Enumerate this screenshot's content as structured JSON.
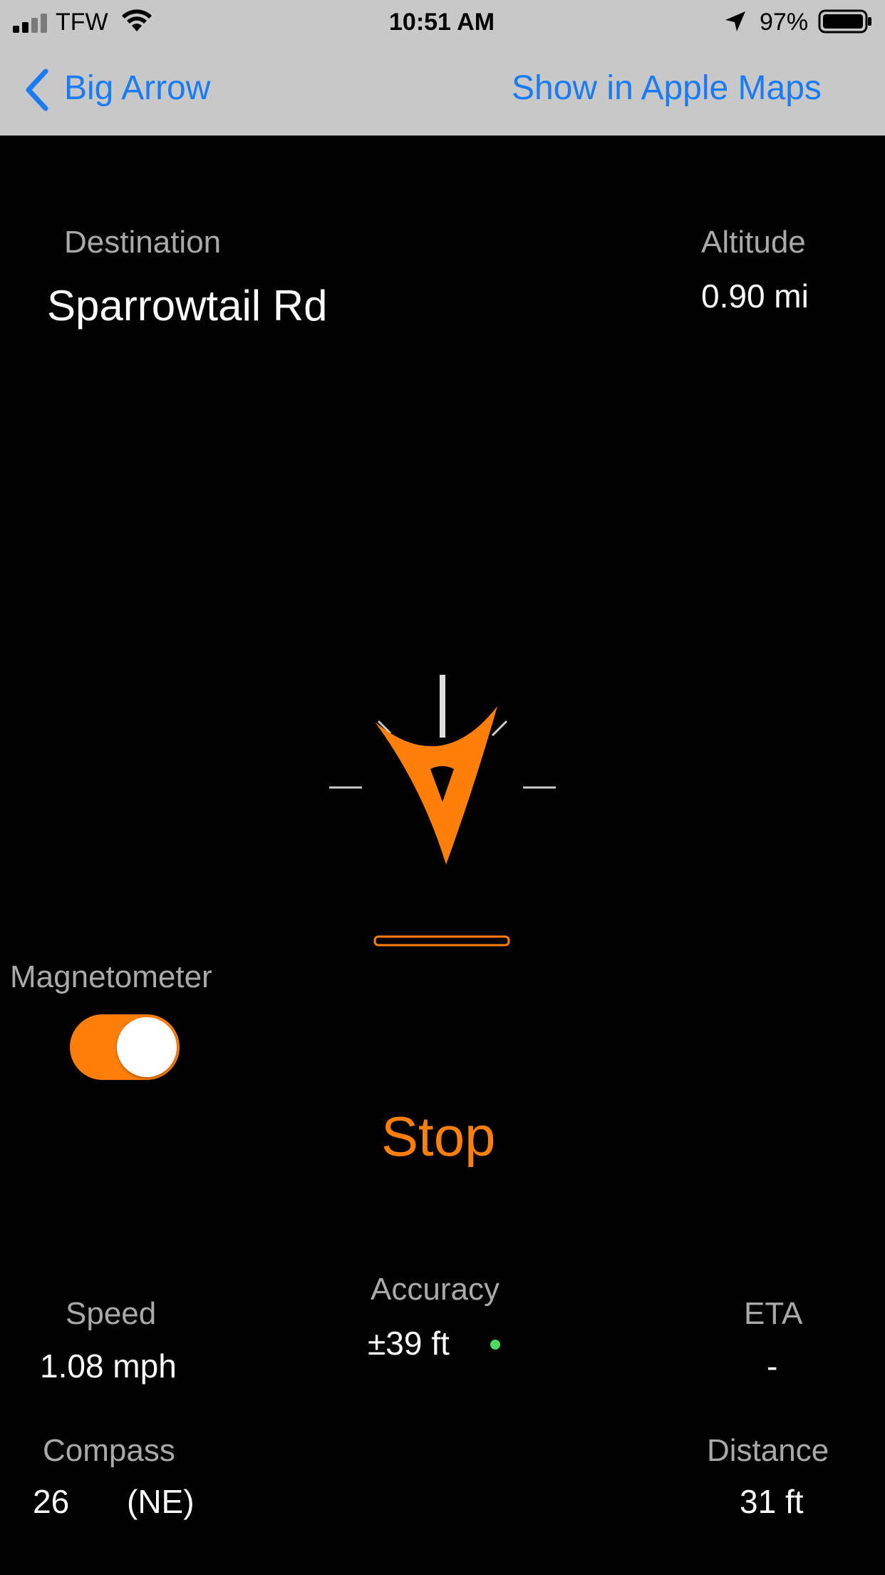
{
  "status_bar": {
    "carrier": "TFW",
    "time": "10:51 AM",
    "battery_percent": "97%"
  },
  "nav": {
    "back_label": "Big Arrow",
    "action_label": "Show in Apple Maps"
  },
  "destination": {
    "label": "Destination",
    "value": "Sparrowtail Rd"
  },
  "altitude": {
    "label": "Altitude",
    "value": "0.90 mi"
  },
  "magnetometer": {
    "label": "Magnetometer",
    "enabled": true
  },
  "stop_label": "Stop",
  "accuracy": {
    "label": "Accuracy",
    "value": "±39 ft",
    "indicator_color": "#4cd964"
  },
  "speed": {
    "label": "Speed",
    "value": "1.08 mph"
  },
  "eta": {
    "label": "ETA",
    "value": "-"
  },
  "compass": {
    "label": "Compass",
    "degrees": "26",
    "direction": "(NE)"
  },
  "distance": {
    "label": "Distance",
    "value": "31 ft"
  },
  "colors": {
    "accent": "#ff7f0a",
    "link": "#1a7cf5",
    "header_bg": "#c8c8c8"
  },
  "icons": [
    "cellular-signal-icon",
    "wifi-icon",
    "location-arrow-icon",
    "battery-icon",
    "chevron-left-icon",
    "direction-arrow-icon"
  ]
}
